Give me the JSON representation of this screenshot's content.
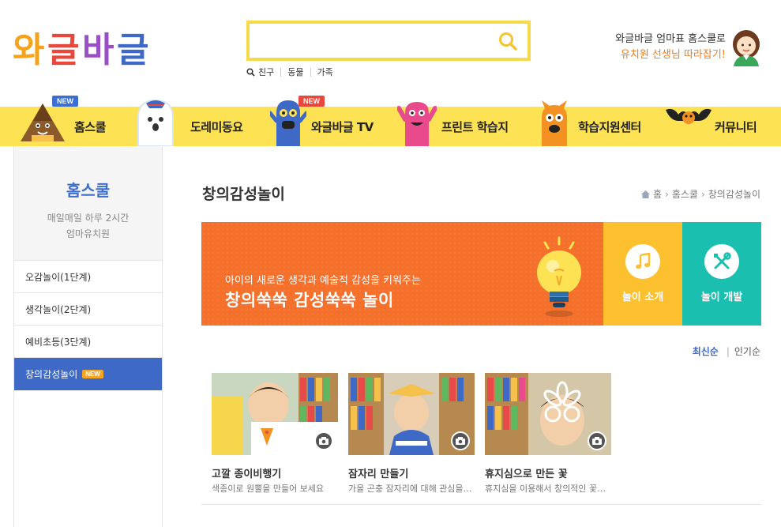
{
  "header": {
    "logo_text": "와글바글",
    "search": {
      "value": "",
      "placeholder": ""
    },
    "search_tags": [
      "친구",
      "동물",
      "가족"
    ],
    "promo_line1": "와글바글 엄마표 홈스쿨로",
    "promo_line2": "유치원 선생님 따라잡기!"
  },
  "nav": {
    "items": [
      {
        "label": "홈스쿨",
        "badge": "NEW"
      },
      {
        "label": "도레미동요"
      },
      {
        "label": "와글바글 TV",
        "badge": "NEW"
      },
      {
        "label": "프린트 학습지"
      },
      {
        "label": "학습지원센터"
      },
      {
        "label": "커뮤니티"
      }
    ]
  },
  "sidebar": {
    "title": "홈스쿨",
    "subtitle_line1": "매일매일 하루 2시간",
    "subtitle_line2": "엄마유치원",
    "items": [
      {
        "label": "오감놀이(1단계)"
      },
      {
        "label": "생각놀이(2단계)"
      },
      {
        "label": "예비초등(3단계)"
      },
      {
        "label": "창의감성놀이",
        "badge": "NEW",
        "active": true
      }
    ]
  },
  "main": {
    "page_title": "창의감성놀이",
    "breadcrumb": [
      "홈",
      "홈스쿨",
      "창의감성놀이"
    ],
    "banner": {
      "subtitle": "아이의 새로운 생각과 예술적 감성을 키워주는",
      "title": "창의쑥쑥 감성쑥쑥 놀이",
      "buttons": [
        {
          "label": "놀이 소개",
          "icon": "music-note-icon"
        },
        {
          "label": "놀이 개발",
          "icon": "tools-icon"
        }
      ]
    },
    "sort": {
      "latest": "최신순",
      "popular": "인기순"
    },
    "cards": [
      {
        "title": "고깔 종이비행기",
        "desc": "색종이로 원뿔을 만들어 보세요"
      },
      {
        "title": "잠자리 만들기",
        "desc": "가을 곤충 잠자리에 대해 관심을 가져요"
      },
      {
        "title": "휴지심으로 만든 꽃",
        "desc": "휴지심을 이용해서 창의적인 꽃을 만들어요"
      }
    ]
  },
  "colors": {
    "nav_bg": "#fde253",
    "accent_blue": "#3e69c6",
    "banner_orange": "#f4702b",
    "banner_yellow": "#fdc02f",
    "banner_teal": "#1bbfb0"
  }
}
